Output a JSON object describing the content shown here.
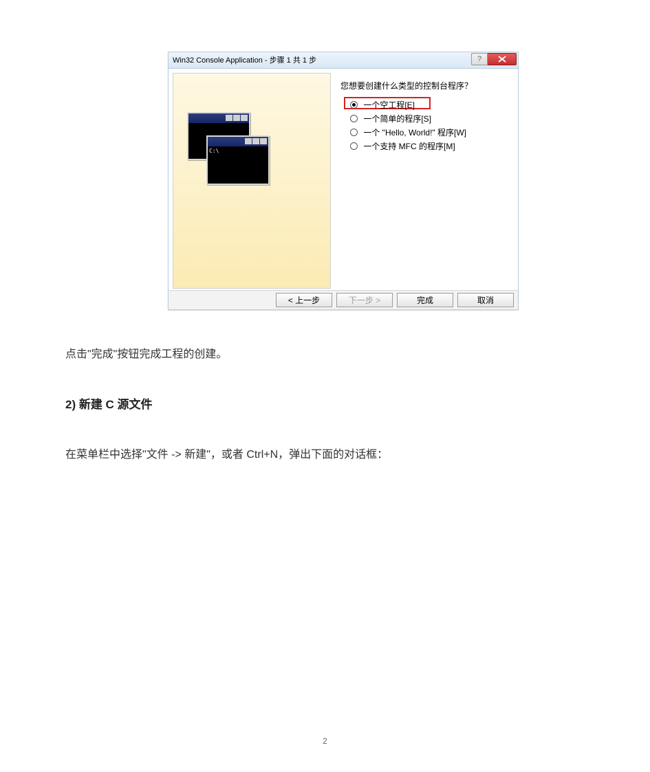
{
  "dialog": {
    "title": "Win32 Console Application - 步骤 1 共 1 步",
    "prompt": "您想要创建什么类型的控制台程序？",
    "options": [
      {
        "label": "一个空工程[E]",
        "checked": true,
        "highlighted": true
      },
      {
        "label": "一个简单的程序[S]",
        "checked": false,
        "highlighted": false
      },
      {
        "label": "一个 \"Hello, World!\" 程序[W]",
        "checked": false,
        "highlighted": false
      },
      {
        "label": "一个支持 MFC 的程序[M]",
        "checked": false,
        "highlighted": false
      }
    ],
    "console_prompt": "C:\\",
    "buttons": {
      "back": "< 上一步",
      "next": "下一步 >",
      "finish": "完成",
      "cancel": "取消"
    },
    "help_char": "?"
  },
  "body": {
    "para1": "点击\"完成\"按钮完成工程的创建。",
    "heading": "2) 新建 C 源文件",
    "para2": "在菜单栏中选择\"文件 -> 新建\"，或者 Ctrl+N，弹出下面的对话框：",
    "page_number": "2"
  }
}
